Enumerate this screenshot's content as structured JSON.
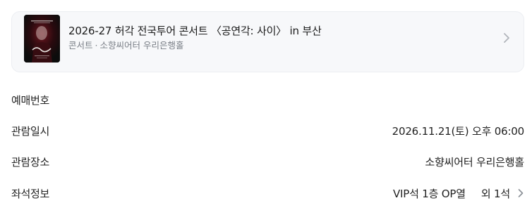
{
  "event": {
    "title": "2026-27 허각 전국투어 콘서트 〈공연각: 사이〉 in 부산",
    "genre": "콘서트",
    "separator": "·",
    "venue": "소향씨어터 우리은행홀",
    "poster_icon": "poster-image",
    "chevron_icon": "chevron-right-icon"
  },
  "details": {
    "booking_number": {
      "label": "예매번호",
      "value": ""
    },
    "show_datetime": {
      "label": "관람일시",
      "value": "2026.11.21(토) 오후 06:00"
    },
    "venue": {
      "label": "관람장소",
      "value": "소향씨어터 우리은행홀"
    },
    "seat": {
      "label": "좌석정보",
      "value": "VIP석 1층 OP열",
      "extra": "외 1석",
      "chevron_icon": "chevron-right-icon"
    }
  },
  "colors": {
    "card_background": "#f7f8fa",
    "secondary_text": "#7a7f87",
    "primary_text": "#222222",
    "chevron": "#b0b4ba"
  }
}
